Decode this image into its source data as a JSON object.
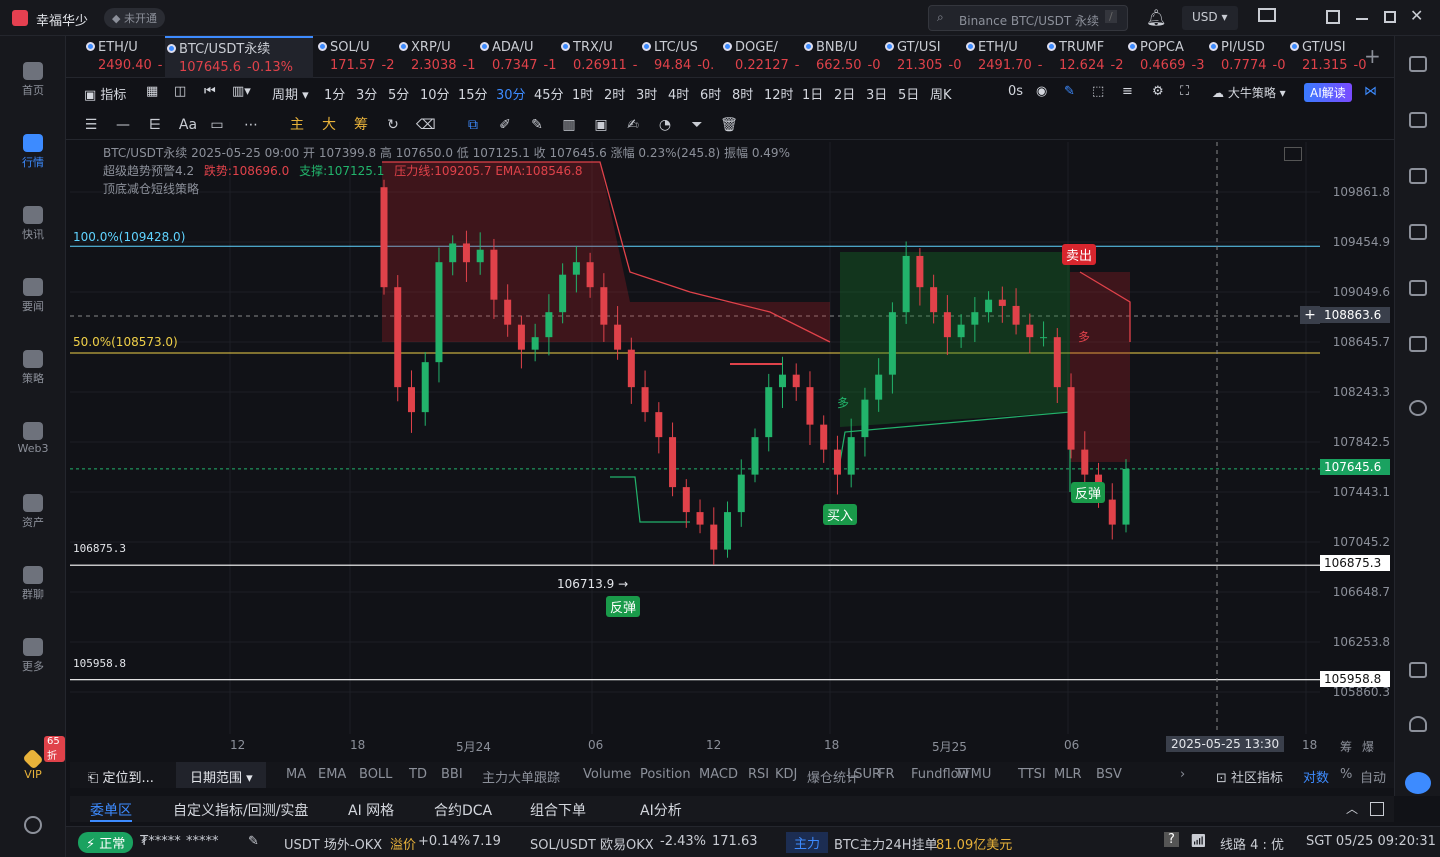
{
  "app": {
    "user_name": "幸福华少",
    "account_status": "未开通",
    "search_placeholder": "Binance BTC/USDT 永续",
    "search_shortcut": "/",
    "currency": "USD"
  },
  "sidebar": {
    "items": [
      {
        "label": "首页",
        "icon": "home-icon"
      },
      {
        "label": "行情",
        "icon": "chart-icon",
        "active": true
      },
      {
        "label": "快讯",
        "icon": "flash-news-icon"
      },
      {
        "label": "要闻",
        "icon": "news-icon"
      },
      {
        "label": "策略",
        "icon": "robot-icon"
      },
      {
        "label": "Web3",
        "icon": "web3-icon"
      },
      {
        "label": "资产",
        "icon": "wallet-icon"
      },
      {
        "label": "群聊",
        "icon": "chat-icon"
      },
      {
        "label": "更多",
        "icon": "grid-icon"
      }
    ],
    "vip_label": "VIP",
    "vip_badge": "65折"
  },
  "tabs": [
    {
      "name": "ETH/U",
      "price": "2490.40",
      "change": "-",
      "dir": "dn"
    },
    {
      "name": "BTC/USDT永续",
      "price": "107645.6",
      "change": "-0.13%",
      "dir": "dn",
      "active": true
    },
    {
      "name": "SOL/U",
      "price": "171.57",
      "change": "-2",
      "dir": "dn"
    },
    {
      "name": "XRP/U",
      "price": "2.3038",
      "change": "-1",
      "dir": "dn"
    },
    {
      "name": "ADA/U",
      "price": "0.7347",
      "change": "-1",
      "dir": "dn"
    },
    {
      "name": "TRX/U",
      "price": "0.26911",
      "change": "-",
      "dir": "dn"
    },
    {
      "name": "LTC/US",
      "price": "94.84",
      "change": "-0.",
      "dir": "dn"
    },
    {
      "name": "DOGE/",
      "price": "0.22127",
      "change": "-",
      "dir": "dn"
    },
    {
      "name": "BNB/U",
      "price": "662.50",
      "change": "-0",
      "dir": "dn"
    },
    {
      "name": "GT/USI",
      "price": "21.305",
      "change": "-0",
      "dir": "dn"
    },
    {
      "name": "ETH/U",
      "price": "2491.70",
      "change": "-",
      "dir": "dn"
    },
    {
      "name": "TRUMF",
      "price": "12.624",
      "change": "-2",
      "dir": "dn"
    },
    {
      "name": "POPCA",
      "price": "0.4669",
      "change": "-3",
      "dir": "dn"
    },
    {
      "name": "PI/USD",
      "price": "0.7774",
      "change": "-0",
      "dir": "dn"
    },
    {
      "name": "GT/USI",
      "price": "21.315",
      "change": "-0",
      "dir": "dn"
    }
  ],
  "toolbar": {
    "indicator": "指标",
    "period": "周期",
    "intervals": [
      "1分",
      "3分",
      "5分",
      "10分",
      "15分",
      "30分",
      "45分",
      "1时",
      "2时",
      "3时",
      "4时",
      "6时",
      "8时",
      "12时",
      "1日",
      "2日",
      "3日",
      "5日",
      "周K"
    ],
    "selected_interval": "30分",
    "countdown": "0s",
    "strategy": "大牛策略",
    "ai": "AI解读"
  },
  "toolbar2": {
    "main": "主",
    "big": "大",
    "chips": "筹",
    "font": "Aa"
  },
  "chart": {
    "info_line1": "BTC/USDT永续 2025-05-25 09:00  开 107399.8  高 107650.0  低 107125.1  收 107645.6  涨幅 0.23%(245.8)  振幅 0.49%",
    "info_line2_name": "超级趋势预警4.2",
    "info_line2_a": "跌势:108696.0",
    "info_line2_b": "支撑:107125.1",
    "info_line2_c": "压力线:109205.7  EMA:108546.8",
    "info_line3": "顶底减仓短线策略",
    "fib_100": "100.0%(109428.0)",
    "fib_50": "50.0%(108573.0)",
    "low_label": "106713.9 →",
    "level1": "106875.3",
    "level2": "105958.8",
    "tag_sell": "卖出",
    "tag_buy": "买入",
    "tag_rebound1": "反弹",
    "tag_rebound2": "反弹",
    "long_label1": "多",
    "long_label2": "多",
    "y_labels": [
      "109861.8",
      "109454.9",
      "109049.6",
      "108645.7",
      "108243.3",
      "107842.5",
      "107443.1",
      "107045.2",
      "106648.7",
      "106253.8",
      "105860.3"
    ],
    "crosshair_price": "108863.6",
    "last_price": "107645.6",
    "x_labels": [
      "12",
      "18",
      "5月24",
      "06",
      "12",
      "18",
      "5月25",
      "06",
      "18"
    ],
    "crosshair_time": "2025-05-25 13:30",
    "x_right": [
      "筹",
      "爆"
    ]
  },
  "chart_data": {
    "type": "candlestick",
    "title": "BTC/USDT永续 30分",
    "ylim": [
      105800,
      110000
    ],
    "last": {
      "open": 107399.8,
      "high": 107650.0,
      "low": 107125.1,
      "close": 107645.6
    },
    "closes_approx": [
      109100,
      108300,
      108100,
      108500,
      109300,
      109450,
      109300,
      109400,
      109000,
      108800,
      108600,
      108700,
      108900,
      109200,
      109300,
      109100,
      108800,
      108600,
      108300,
      108100,
      107900,
      107500,
      107300,
      107200,
      107000,
      107300,
      107600,
      107900,
      108300,
      108400,
      108300,
      108000,
      107800,
      107600,
      107900,
      108200,
      108400,
      108900,
      109350,
      109100,
      108900,
      108700,
      108800,
      108900,
      109000,
      108950,
      108800,
      108700,
      108700,
      108300,
      107800,
      107600,
      107400,
      107200,
      107645.6
    ],
    "fib_levels": {
      "100%": 109428.0,
      "50%": 108573.0
    },
    "h_levels": [
      106875.3,
      105958.8
    ],
    "signals": [
      {
        "label": "反弹",
        "price": 106713.9
      },
      {
        "label": "买入"
      },
      {
        "label": "卖出"
      },
      {
        "label": "反弹"
      }
    ]
  },
  "indicators": {
    "locate": "定位到...",
    "date_range": "日期范围",
    "main": [
      "MA",
      "EMA",
      "BOLL",
      "TD",
      "BBI",
      "主力大单跟踪"
    ],
    "sub": [
      "Volume",
      "Position",
      "MACD",
      "RSI",
      "KDJ",
      "爆仓统计",
      "LSUR",
      "FR",
      "Fundflow",
      "TTMU",
      "TTSI",
      "MLR",
      "BSV"
    ],
    "community": "社区指标",
    "log": "对数",
    "pct": "%",
    "auto": "自动"
  },
  "bottom_tabs": [
    "委单区",
    "自定义指标/回测/实盘",
    "AI 网格",
    "合约DCA",
    "组合下单",
    "AI分析"
  ],
  "status": {
    "state": "正常",
    "masked1": "₮*****",
    "masked2": "*****",
    "usdt_label": "USDT 场外-OKX",
    "premium_label": "溢价",
    "premium": "+0.14%",
    "usdt_price": "7.19",
    "sol_label": "SOL/USDT 欧易OKX",
    "sol_change": "-2.43%",
    "sol_price": "171.63",
    "main_force": "主力",
    "btc_main": "BTC主力24H挂单",
    "btc_amount": "81.09亿美元",
    "line": "线路 4 : 优",
    "time": "SGT 05/25 09:20:31"
  }
}
